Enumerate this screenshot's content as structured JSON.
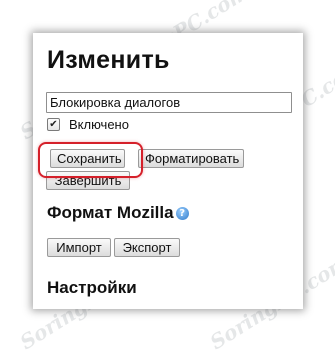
{
  "panel": {
    "title": "Изменить",
    "name_value": "Блокировка диалогов",
    "enabled_label": "Включено",
    "enabled_checked": true,
    "checkmark": "✔",
    "buttons": {
      "save": "Сохранить",
      "format": "Форматировать",
      "finish": "Завершить",
      "import": "Импорт",
      "export": "Экспорт"
    },
    "format_heading": "Формат Mozilla",
    "help_glyph": "?",
    "settings_heading": "Настройки"
  },
  "watermark_text": "SoringPC.com",
  "colors": {
    "highlight": "#d5202a",
    "help_icon": "#2e78c8"
  }
}
